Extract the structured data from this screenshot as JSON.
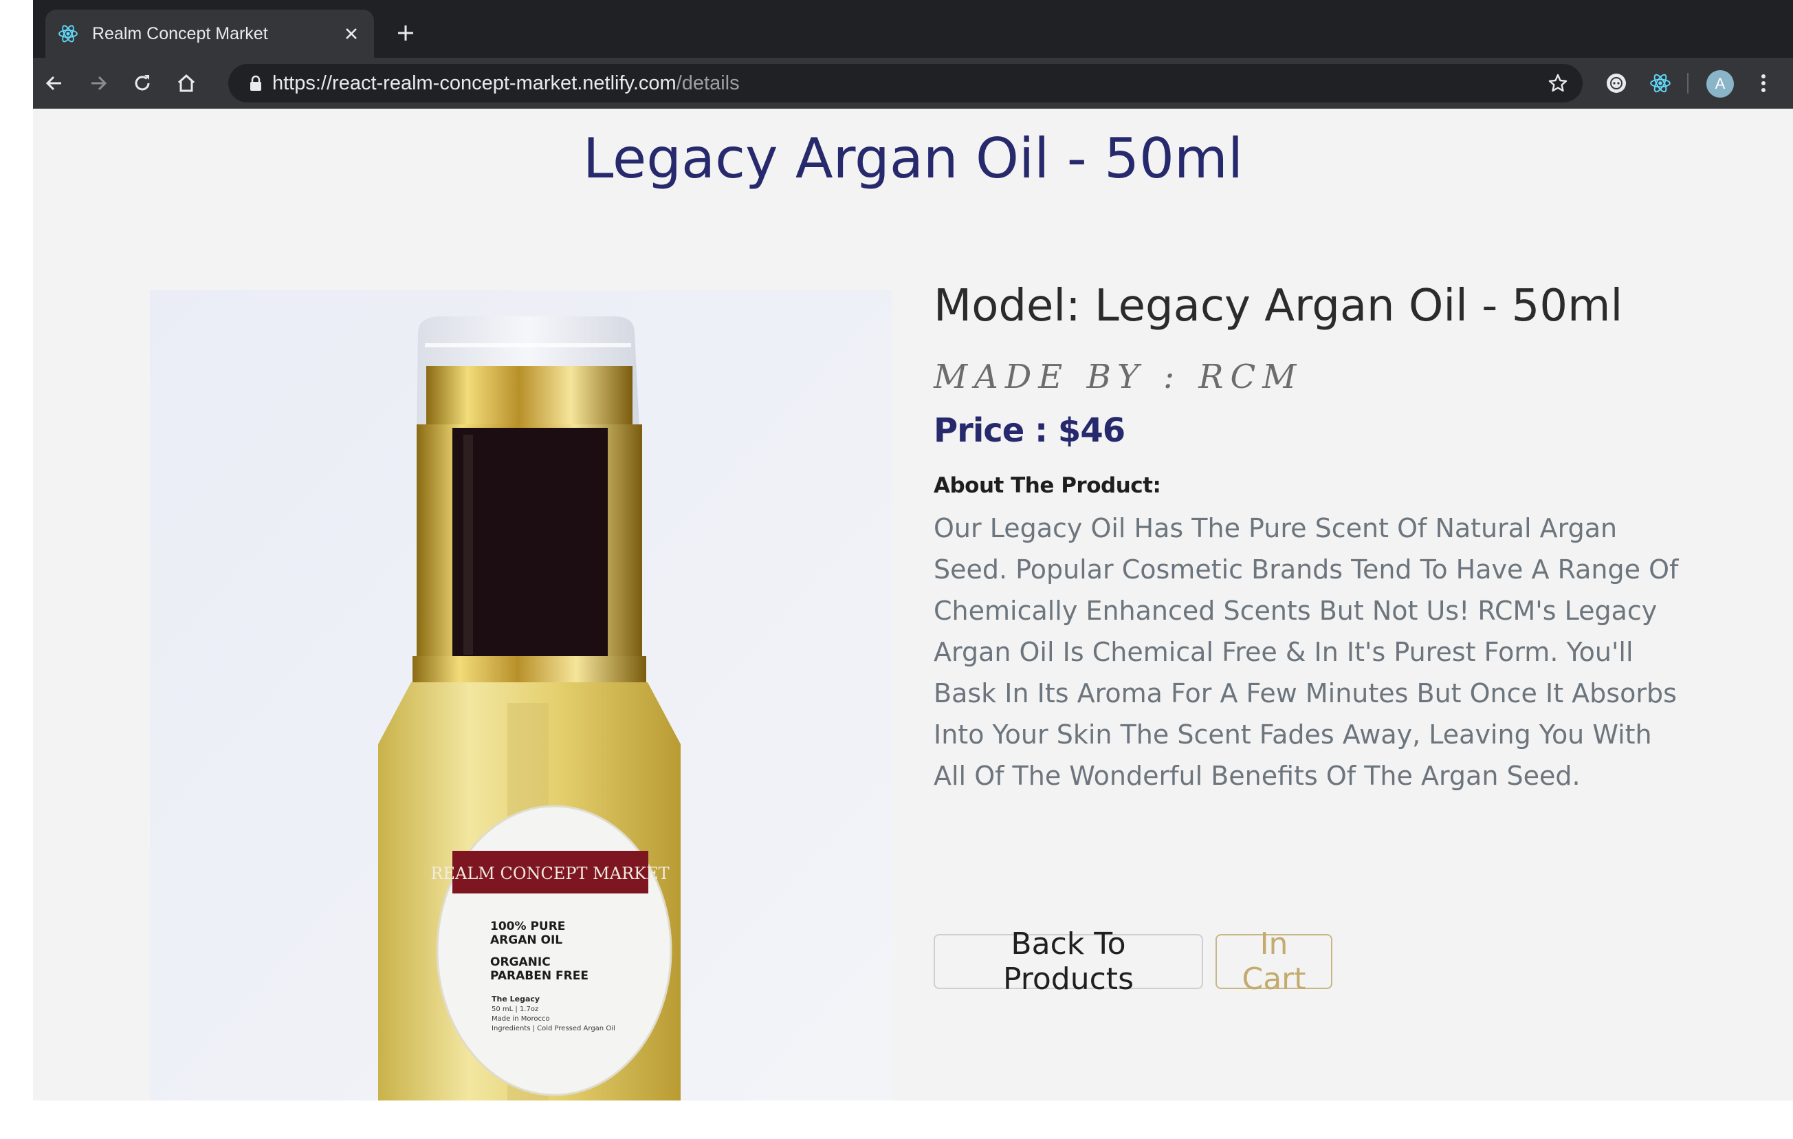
{
  "browser": {
    "tab_title": "Realm Concept Market",
    "url_host": "https://react-realm-concept-market.netlify.com",
    "url_path": "/details",
    "avatar_letter": "A"
  },
  "page": {
    "title": "Legacy Argan Oil - 50ml"
  },
  "product": {
    "model": "Model: Legacy Argan Oil - 50ml",
    "made_by": "MADE BY : RCM",
    "price": "Price : $46",
    "about_label": "About The Product:",
    "description": "Our Legacy Oil Has The Pure Scent Of Natural Argan Seed. Popular Cosmetic Brands Tend To Have A Range Of Chemically Enhanced Scents But Not Us! RCM's Legacy Argan Oil Is Chemical Free & In It's Purest Form. You'll Bask In Its Aroma For A Few Minutes But Once It Absorbs Into Your Skin The Scent Fades Away, Leaving You With All Of The Wonderful Benefits Of The Argan Seed.",
    "label": {
      "brand": "REALM CONCEPT MARKET",
      "line1": "100% PURE",
      "line2": "ARGAN OIL",
      "line3": "ORGANIC",
      "line4": "PARABEN FREE",
      "small1": "The Legacy",
      "small2": "50 mL | 1.7oz",
      "small3": "Made in Morocco",
      "small4": "Ingredients | Cold Pressed Argan Oil"
    }
  },
  "buttons": {
    "back": "Back To Products",
    "cart": "In Cart"
  },
  "colors": {
    "title": "#27296d",
    "price": "#27296d",
    "cart_accent": "#c3ab6e",
    "description": "#6c757d"
  },
  "icons": {
    "favicon": "react-atom-icon",
    "back": "arrow-left-icon",
    "forward": "arrow-right-icon",
    "reload": "reload-icon",
    "home": "home-icon",
    "lock": "lock-icon",
    "bookmark": "star-icon"
  }
}
